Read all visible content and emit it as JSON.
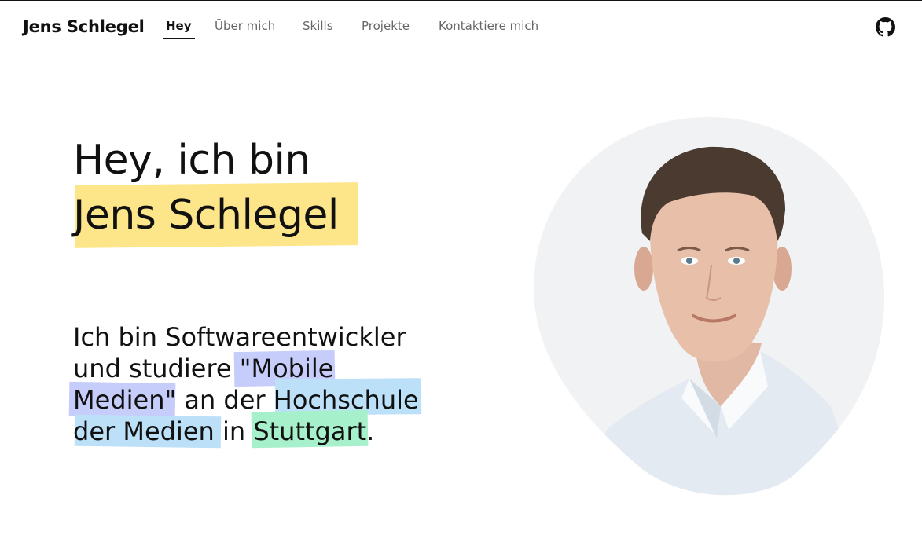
{
  "header": {
    "brand": "Jens Schlegel",
    "nav": [
      {
        "label": "Hey",
        "active": true
      },
      {
        "label": "Über mich",
        "active": false
      },
      {
        "label": "Skills",
        "active": false
      },
      {
        "label": "Projekte",
        "active": false
      },
      {
        "label": "Kontaktiere mich",
        "active": false
      }
    ],
    "github_icon": "github-icon"
  },
  "hero": {
    "title_line1": "Hey, ich bin",
    "title_line2": "Jens Schlegel",
    "intro_lines": [
      "Ich bin Softwareentwickler",
      "und studiere \"Mobile",
      "Medien\" an der Hochschule",
      "der Medien in Stuttgart."
    ]
  },
  "colors": {
    "highlight_yellow": "#fde68a",
    "highlight_purple": "#c7cdfa",
    "highlight_blue": "#bde0f9",
    "highlight_green": "#a7f0cc",
    "photo_background": "#f1f2f4"
  }
}
